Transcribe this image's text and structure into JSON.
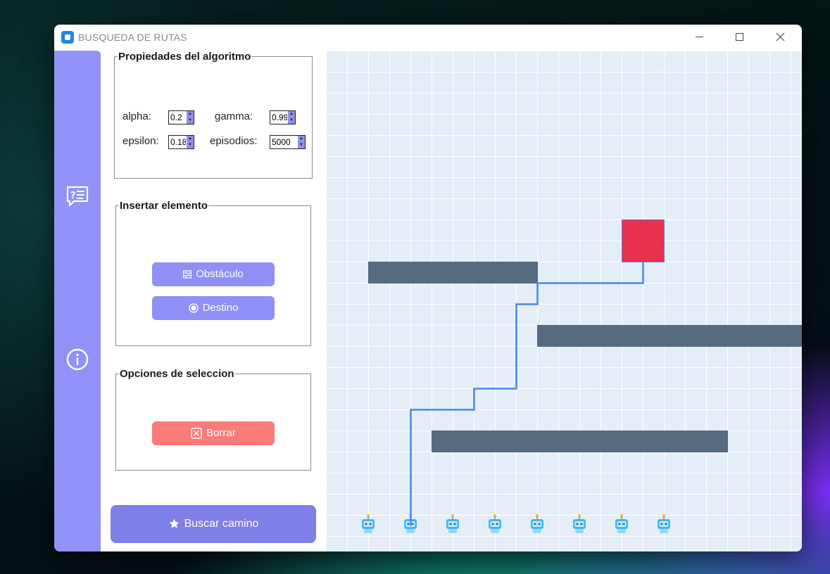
{
  "window": {
    "title": "BUSQUEDA DE RUTAS",
    "controls": {
      "minimize": "minimize-icon",
      "maximize": "maximize-icon",
      "close": "close-icon"
    }
  },
  "sidebar": {
    "items": [
      {
        "icon": "help-chat-icon"
      },
      {
        "icon": "info-icon"
      }
    ]
  },
  "algorithm": {
    "legend": "Propiedades del algoritmo",
    "alpha_label": "alpha:",
    "alpha_value": "0.2",
    "gamma_label": "gamma:",
    "gamma_value": "0.99",
    "epsilon_label": "epsilon:",
    "epsilon_value": "0.18",
    "episodes_label": "episodios:",
    "episodes_value": "5000"
  },
  "insert": {
    "legend": "Insertar elemento",
    "obstacle_label": "Obstáculo",
    "destination_label": "Destino"
  },
  "selection": {
    "legend": "Opciones de seleccion",
    "delete_label": "Borrar"
  },
  "search": {
    "label": "Buscar camino"
  },
  "colors": {
    "accent": "#9191f7",
    "obstacle": "#566a80",
    "target": "#e8304f",
    "path": "#4a86e8",
    "delete": "#fb7b7b",
    "grid_background": "#e5edf7"
  },
  "grid": {
    "columns": 23,
    "rows": 24,
    "obstacles": [
      {
        "col": 2,
        "row": 10,
        "w": 8,
        "h": 1
      },
      {
        "col": 10,
        "row": 13,
        "w": 13,
        "h": 1
      },
      {
        "col": 5,
        "row": 18,
        "w": 14,
        "h": 1
      }
    ],
    "target": {
      "col": 14,
      "row": 8
    },
    "robot_cols": [
      2,
      4,
      6,
      8,
      10,
      12,
      14,
      16
    ],
    "robot_row": 22.5,
    "path": [
      [
        4,
        22.5
      ],
      [
        4,
        17
      ],
      [
        7,
        17
      ],
      [
        7,
        16
      ],
      [
        9,
        16
      ],
      [
        9,
        12
      ],
      [
        10,
        12
      ],
      [
        10,
        11
      ],
      [
        15,
        11
      ],
      [
        15,
        10
      ]
    ]
  }
}
